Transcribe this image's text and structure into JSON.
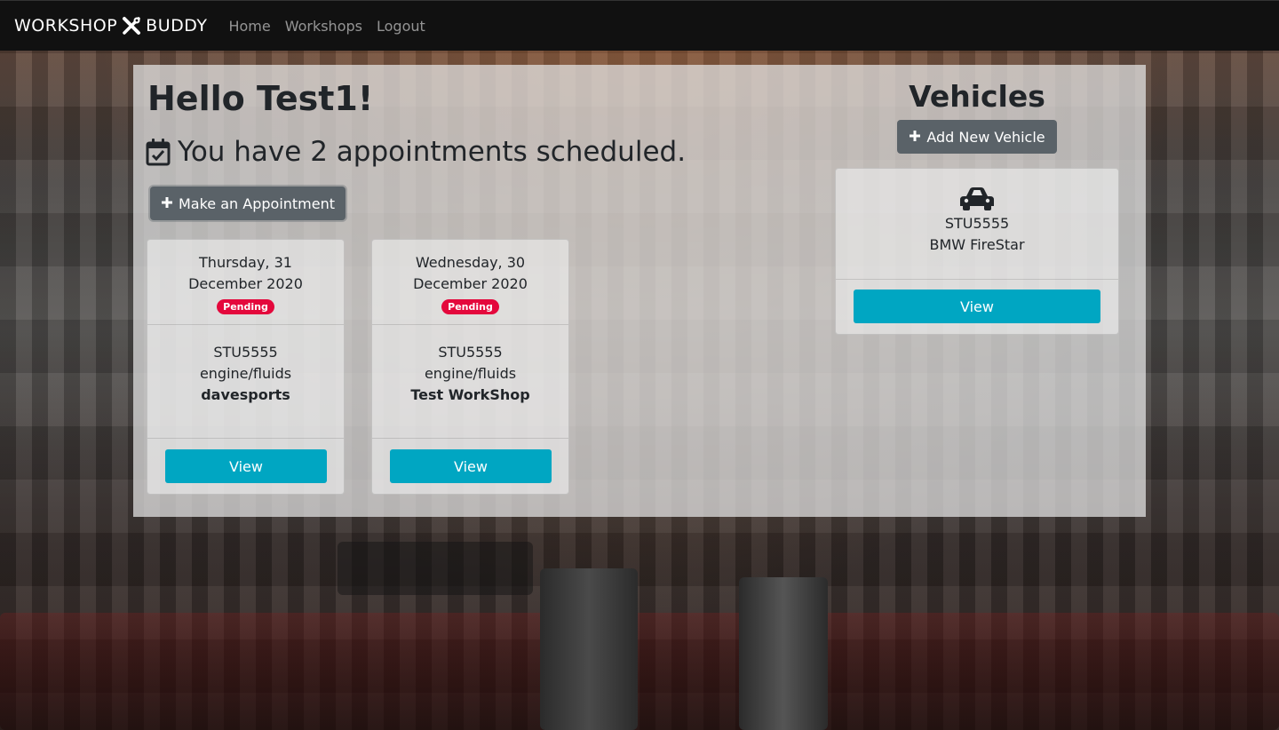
{
  "navbar": {
    "brand_left": "WORKSHOP",
    "brand_right": "BUDDY",
    "brand_icon": "tools-icon",
    "links": [
      "Home",
      "Workshops",
      "Logout"
    ]
  },
  "greeting": {
    "prefix": "Hello ",
    "username": "Test1",
    "suffix": "!"
  },
  "appointments_summary": "You have 2 appointments scheduled.",
  "make_appointment_label": "Make an Appointment",
  "appointments": [
    {
      "date_line1": "Thursday, 31",
      "date_line2": "December 2020",
      "status": "Pending",
      "plate": "STU5555",
      "service": "engine/fluids",
      "workshop": "davesports",
      "view_label": "View"
    },
    {
      "date_line1": "Wednesday, 30",
      "date_line2": "December 2020",
      "status": "Pending",
      "plate": "STU5555",
      "service": "engine/fluids",
      "workshop": "Test WorkShop",
      "view_label": "View"
    }
  ],
  "vehicles": {
    "title": "Vehicles",
    "add_label": "Add New Vehicle",
    "items": [
      {
        "plate": "STU5555",
        "model": "BMW FireStar",
        "view_label": "View",
        "icon": "car-icon"
      }
    ]
  },
  "colors": {
    "navbar": "#111111",
    "pending_badge": "#e4083c",
    "view_button": "#00a6c2",
    "secondary_button": "#5a6268"
  }
}
